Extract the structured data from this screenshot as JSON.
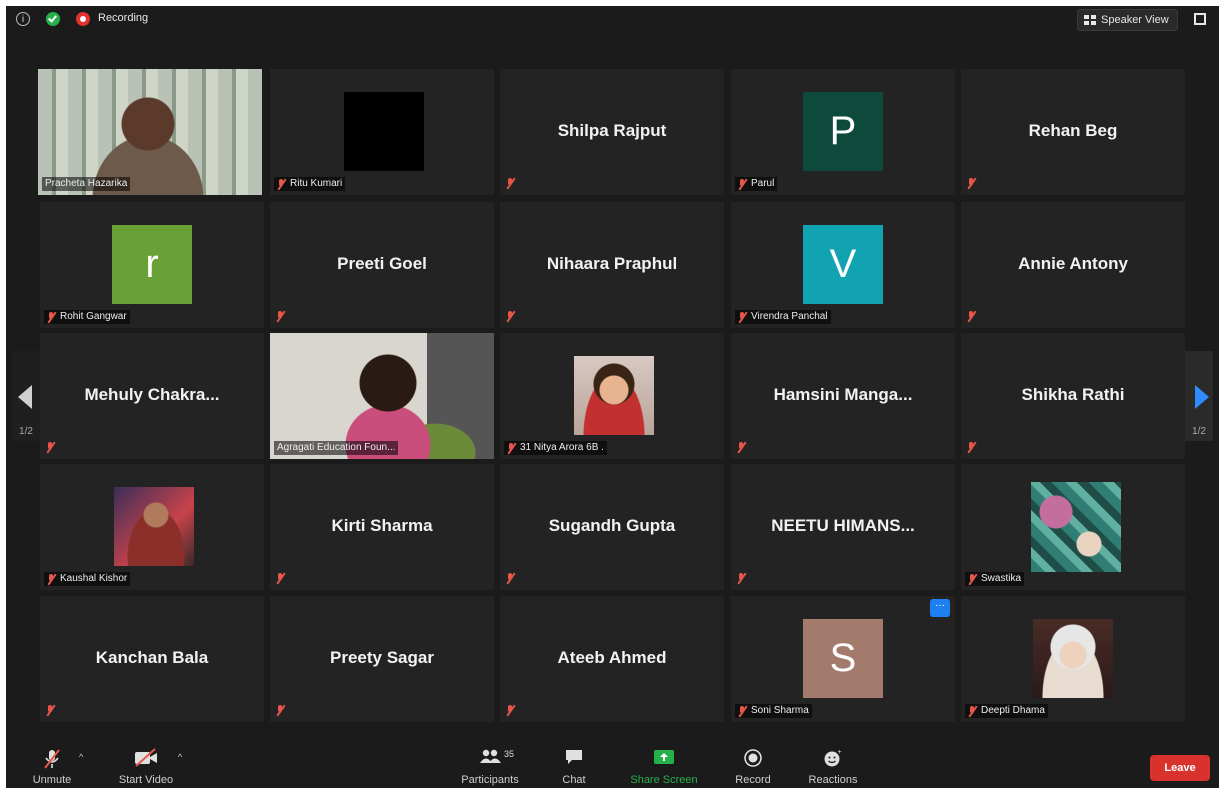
{
  "topbar": {
    "recording_label": "Recording",
    "speaker_view_label": "Speaker View"
  },
  "paging": {
    "prev_page": "1/2",
    "next_page": "1/2"
  },
  "participants": [
    {
      "id": "pracheta",
      "label": "Pracheta Hazarika",
      "type": "video",
      "active": true
    },
    {
      "id": "ritu",
      "label": "Ritu Kumari",
      "type": "black",
      "muted": true
    },
    {
      "id": "shilpa",
      "name": "Shilpa Rajput",
      "type": "name",
      "muted": true
    },
    {
      "id": "parul",
      "label": "Parul",
      "type": "avatar",
      "initial": "P",
      "color": "#0e4a3c",
      "muted": true
    },
    {
      "id": "rehan",
      "name": "Rehan Beg",
      "type": "name",
      "muted": true
    },
    {
      "id": "rohit",
      "label": "Rohit Gangwar",
      "type": "avatar",
      "initial": "r",
      "color": "#6aa136",
      "muted": true
    },
    {
      "id": "preeti",
      "name": "Preeti Goel",
      "type": "name",
      "muted": true
    },
    {
      "id": "nihaara",
      "name": "Nihaara Praphul",
      "type": "name",
      "muted": true
    },
    {
      "id": "virendra",
      "label": "Virendra Panchal",
      "type": "avatar",
      "initial": "V",
      "color": "#11a3b2",
      "muted": true
    },
    {
      "id": "annie",
      "name": "Annie Antony",
      "type": "name",
      "muted": true
    },
    {
      "id": "mehuly",
      "name": "Mehuly  Chakra...",
      "type": "name",
      "muted": true
    },
    {
      "id": "agragati",
      "label": "Agragati Education Foun...",
      "type": "video"
    },
    {
      "id": "nitya",
      "label": "31 Nitya Arora 6B .",
      "type": "photo",
      "muted": true
    },
    {
      "id": "hamsini",
      "name": "Hamsini  Manga...",
      "type": "name",
      "muted": true
    },
    {
      "id": "shikha",
      "name": "Shikha Rathi",
      "type": "name",
      "muted": true
    },
    {
      "id": "kaushal",
      "label": "Kaushal Kishor",
      "type": "photo",
      "muted": true
    },
    {
      "id": "kirti",
      "name": "Kirti Sharma",
      "type": "name",
      "muted": true
    },
    {
      "id": "sugandh",
      "name": "Sugandh Gupta",
      "type": "name",
      "muted": true
    },
    {
      "id": "neetu",
      "name": "NEETU  HIMANS...",
      "type": "name",
      "muted": true
    },
    {
      "id": "swastika",
      "label": "Swastika",
      "type": "photo",
      "muted": true
    },
    {
      "id": "kanchan",
      "name": "Kanchan Bala",
      "type": "name",
      "muted": true
    },
    {
      "id": "preety",
      "name": "Preety Sagar",
      "type": "name",
      "muted": true
    },
    {
      "id": "ateeb",
      "name": "Ateeb Ahmed",
      "type": "name",
      "muted": true
    },
    {
      "id": "soni",
      "label": "Soni Sharma",
      "type": "avatar",
      "initial": "S",
      "color": "#a37b6c",
      "muted": true,
      "more_menu": "···"
    },
    {
      "id": "deepti",
      "label": "Deepti Dhama",
      "type": "photo",
      "muted": true
    }
  ],
  "toolbar": {
    "unmute": "Unmute",
    "start_video": "Start Video",
    "participants": "Participants",
    "participants_count": "35",
    "chat": "Chat",
    "share_screen": "Share Screen",
    "record": "Record",
    "reactions": "Reactions",
    "leave": "Leave"
  },
  "colors": {
    "active_speaker_border": "#c6e65b",
    "share_screen_green": "#27b04a",
    "leave_red": "#d7322b",
    "next_arrow_blue": "#2d8cff",
    "mic_off_red": "#e6574a"
  }
}
